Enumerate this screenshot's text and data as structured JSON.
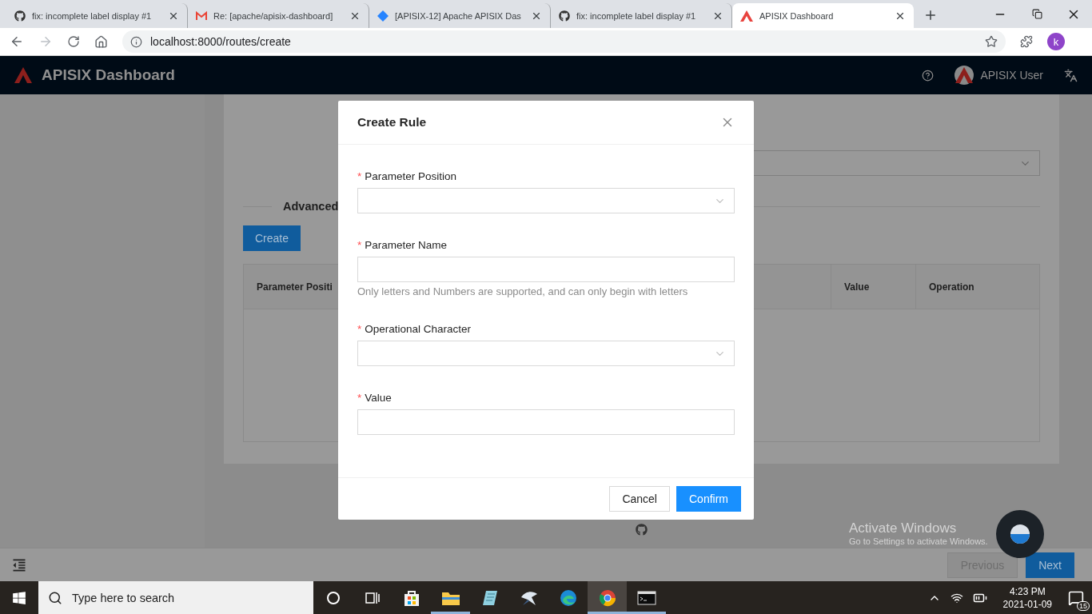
{
  "browser": {
    "tabs": [
      {
        "title": "fix: incomplete label display #1",
        "kind": "github",
        "selected": false
      },
      {
        "title": "Re: [apache/apisix-dashboard]",
        "kind": "mail",
        "selected": false
      },
      {
        "title": "[APISIX-12] Apache APISIX Das",
        "kind": "diamond",
        "selected": false
      },
      {
        "title": "fix: incomplete label display #1",
        "kind": "github",
        "selected": false
      },
      {
        "title": "APISIX Dashboard",
        "kind": "apisix",
        "selected": true
      }
    ],
    "url": "localhost:8000/routes/create",
    "profile_initial": "k"
  },
  "header": {
    "title": "APISIX Dashboard",
    "user": "APISIX User"
  },
  "page": {
    "section_title": "Advanced",
    "create_button": "Create",
    "table": {
      "columns": [
        "Parameter Positi",
        "Value",
        "Operation"
      ]
    },
    "previous_button": "Previous",
    "next_button": "Next"
  },
  "modal": {
    "title": "Create Rule",
    "required_mark": "*",
    "fields": [
      {
        "label": "Parameter Position",
        "required": true,
        "kind": "select"
      },
      {
        "label": "Parameter Name",
        "required": true,
        "kind": "input",
        "help": "Only letters and Numbers are supported, and can only begin with letters"
      },
      {
        "label": "Operational Character",
        "required": true,
        "kind": "select"
      },
      {
        "label": "Value",
        "required": true,
        "kind": "input"
      }
    ],
    "cancel_button": "Cancel",
    "confirm_button": "Confirm"
  },
  "os_notice": {
    "title": "Activate Windows",
    "text": "Go to Settings to activate Windows."
  },
  "taskbar": {
    "search_placeholder": "Type here to search",
    "apps": [
      {
        "kind": "cortana",
        "running": false,
        "selected": false
      },
      {
        "kind": "taskview",
        "running": false,
        "selected": false
      },
      {
        "kind": "store",
        "running": false,
        "selected": false
      },
      {
        "kind": "explorer",
        "running": true,
        "selected": false
      },
      {
        "kind": "notepad",
        "running": false,
        "selected": false
      },
      {
        "kind": "bird",
        "running": false,
        "selected": false
      },
      {
        "kind": "edge",
        "running": false,
        "selected": false
      },
      {
        "kind": "chrome",
        "running": true,
        "selected": true
      },
      {
        "kind": "terminal",
        "running": true,
        "selected": false
      }
    ],
    "time": "4:23 PM",
    "date": "2021-01-09",
    "notifications": "15"
  }
}
